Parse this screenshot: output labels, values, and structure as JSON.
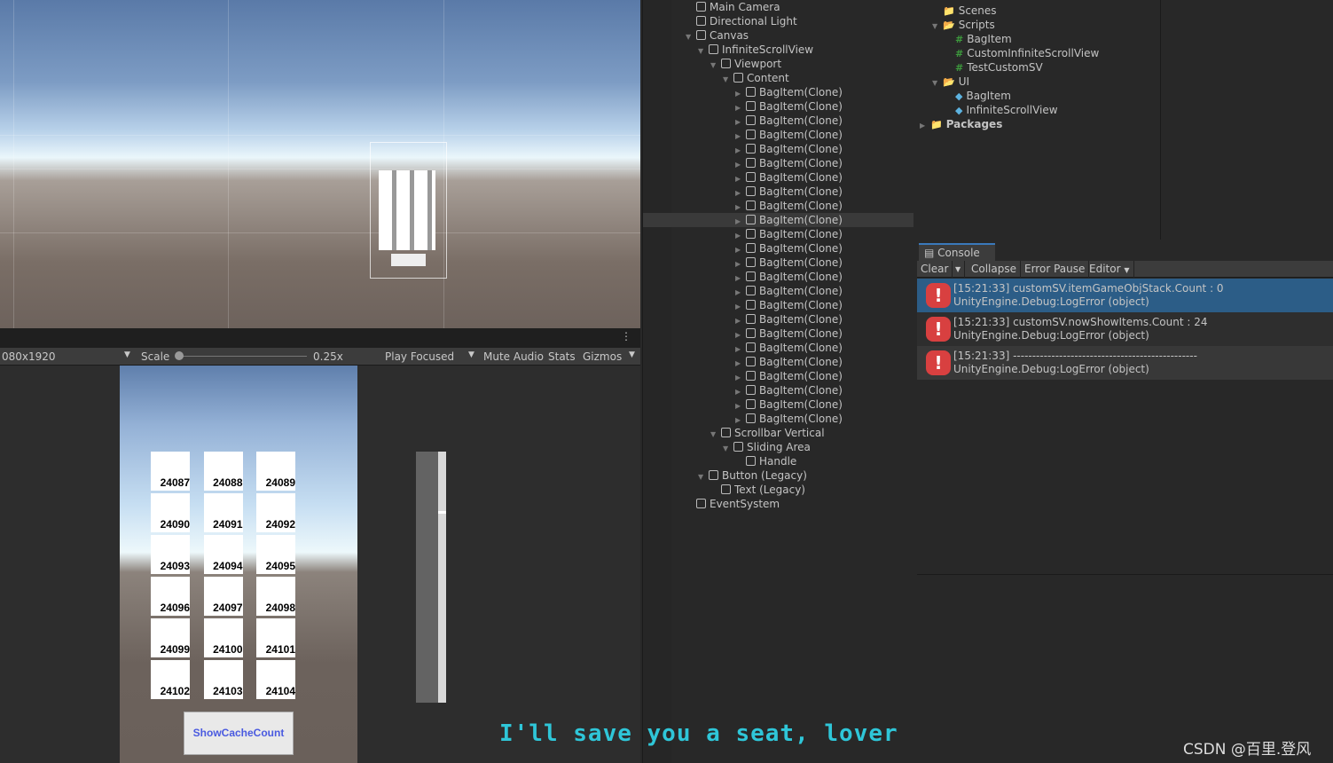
{
  "game_toolbar": {
    "resolution": "080x1920",
    "scale_label": "Scale",
    "scale_value": "0.25x",
    "play_focused": "Play Focused",
    "mute_audio": "Mute Audio",
    "stats": "Stats",
    "gizmos": "Gizmos"
  },
  "game": {
    "cells": [
      "24087",
      "24088",
      "24089",
      "24090",
      "24091",
      "24092",
      "24093",
      "24094",
      "24095",
      "24096",
      "24097",
      "24098",
      "24099",
      "24100",
      "24101",
      "24102",
      "24103",
      "24104"
    ],
    "button": "ShowCacheCount"
  },
  "hierarchy": [
    {
      "label": "Main Camera",
      "depth": 0,
      "arrow": ""
    },
    {
      "label": "Directional Light",
      "depth": 0,
      "arrow": ""
    },
    {
      "label": "Canvas",
      "depth": 0,
      "arrow": "▼"
    },
    {
      "label": "InfiniteScrollView",
      "depth": 1,
      "arrow": "▼"
    },
    {
      "label": "Viewport",
      "depth": 2,
      "arrow": "▼"
    },
    {
      "label": "Content",
      "depth": 3,
      "arrow": "▼"
    },
    {
      "label": "BagItem(Clone)",
      "depth": 4,
      "arrow": "▶"
    },
    {
      "label": "BagItem(Clone)",
      "depth": 4,
      "arrow": "▶"
    },
    {
      "label": "BagItem(Clone)",
      "depth": 4,
      "arrow": "▶"
    },
    {
      "label": "BagItem(Clone)",
      "depth": 4,
      "arrow": "▶"
    },
    {
      "label": "BagItem(Clone)",
      "depth": 4,
      "arrow": "▶"
    },
    {
      "label": "BagItem(Clone)",
      "depth": 4,
      "arrow": "▶"
    },
    {
      "label": "BagItem(Clone)",
      "depth": 4,
      "arrow": "▶"
    },
    {
      "label": "BagItem(Clone)",
      "depth": 4,
      "arrow": "▶"
    },
    {
      "label": "BagItem(Clone)",
      "depth": 4,
      "arrow": "▶"
    },
    {
      "label": "BagItem(Clone)",
      "depth": 4,
      "arrow": "▶",
      "selected": true
    },
    {
      "label": "BagItem(Clone)",
      "depth": 4,
      "arrow": "▶"
    },
    {
      "label": "BagItem(Clone)",
      "depth": 4,
      "arrow": "▶"
    },
    {
      "label": "BagItem(Clone)",
      "depth": 4,
      "arrow": "▶"
    },
    {
      "label": "BagItem(Clone)",
      "depth": 4,
      "arrow": "▶"
    },
    {
      "label": "BagItem(Clone)",
      "depth": 4,
      "arrow": "▶"
    },
    {
      "label": "BagItem(Clone)",
      "depth": 4,
      "arrow": "▶"
    },
    {
      "label": "BagItem(Clone)",
      "depth": 4,
      "arrow": "▶"
    },
    {
      "label": "BagItem(Clone)",
      "depth": 4,
      "arrow": "▶"
    },
    {
      "label": "BagItem(Clone)",
      "depth": 4,
      "arrow": "▶"
    },
    {
      "label": "BagItem(Clone)",
      "depth": 4,
      "arrow": "▶"
    },
    {
      "label": "BagItem(Clone)",
      "depth": 4,
      "arrow": "▶"
    },
    {
      "label": "BagItem(Clone)",
      "depth": 4,
      "arrow": "▶"
    },
    {
      "label": "BagItem(Clone)",
      "depth": 4,
      "arrow": "▶"
    },
    {
      "label": "BagItem(Clone)",
      "depth": 4,
      "arrow": "▶"
    },
    {
      "label": "Scrollbar Vertical",
      "depth": 2,
      "arrow": "▼"
    },
    {
      "label": "Sliding Area",
      "depth": 3,
      "arrow": "▼"
    },
    {
      "label": "Handle",
      "depth": 4,
      "arrow": ""
    },
    {
      "label": "Button (Legacy)",
      "depth": 1,
      "arrow": "▼"
    },
    {
      "label": "Text (Legacy)",
      "depth": 2,
      "arrow": ""
    },
    {
      "label": "EventSystem",
      "depth": 0,
      "arrow": ""
    }
  ],
  "project": [
    {
      "label": "Scenes",
      "depth": 1,
      "icon": "folder",
      "arrow": ""
    },
    {
      "label": "Scripts",
      "depth": 1,
      "icon": "folder-open",
      "arrow": "▼"
    },
    {
      "label": "BagItem",
      "depth": 2,
      "icon": "script",
      "arrow": ""
    },
    {
      "label": "CustomInfiniteScrollView",
      "depth": 2,
      "icon": "script",
      "arrow": ""
    },
    {
      "label": "TestCustomSV",
      "depth": 2,
      "icon": "script",
      "arrow": ""
    },
    {
      "label": "UI",
      "depth": 1,
      "icon": "folder-open",
      "arrow": "▼"
    },
    {
      "label": "BagItem",
      "depth": 2,
      "icon": "prefab",
      "arrow": ""
    },
    {
      "label": "InfiniteScrollView",
      "depth": 2,
      "icon": "prefab",
      "arrow": ""
    },
    {
      "label": "Packages",
      "depth": 0,
      "icon": "folder",
      "arrow": "▶",
      "bold": true
    }
  ],
  "console": {
    "tab": "Console",
    "clear": "Clear",
    "collapse": "Collapse",
    "error_pause": "Error Pause",
    "editor": "Editor",
    "logs": [
      {
        "line1": "[15:21:33] customSV.itemGameObjStack.Count : 0",
        "line2": "UnityEngine.Debug:LogError (object)",
        "selected": true
      },
      {
        "line1": "[15:21:33] customSV.nowShowItems.Count : 24",
        "line2": "UnityEngine.Debug:LogError (object)"
      },
      {
        "line1": "[15:21:33] ------------------------------------------------",
        "line2": "UnityEngine.Debug:LogError (object)"
      }
    ]
  },
  "subtitle": "I'll save you a seat, lover",
  "watermark": "CSDN @百里.登风",
  "colors": {
    "selected_log": "#2c5d87",
    "error": "#d84040",
    "subtitle": "#2fc6d8",
    "button_text": "#4a5ae0"
  }
}
